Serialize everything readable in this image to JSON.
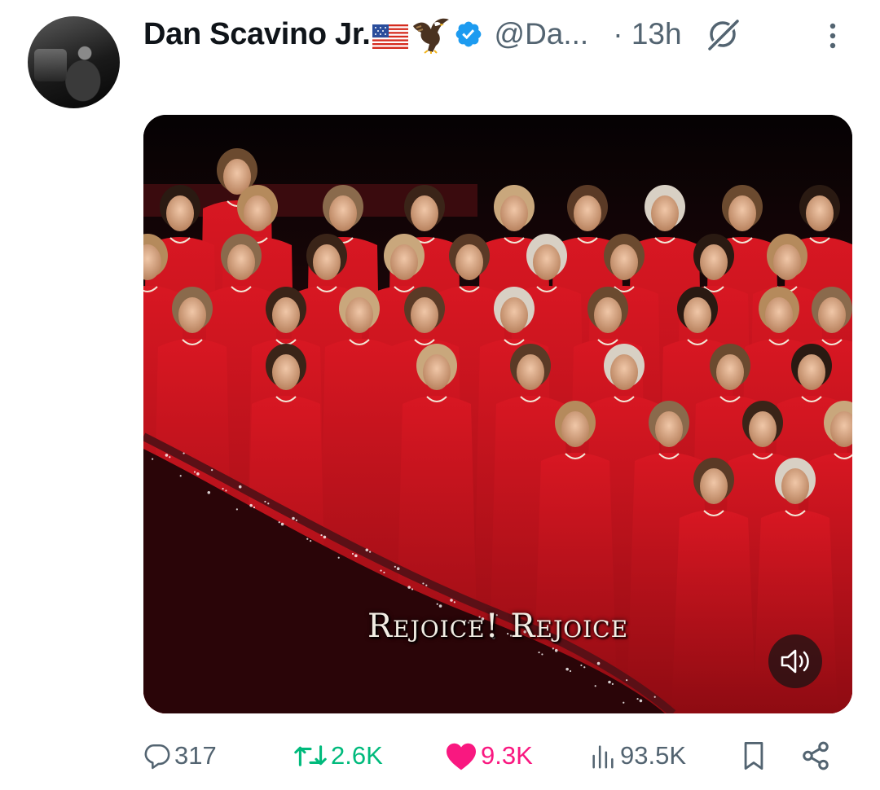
{
  "post": {
    "author_name": "Dan Scavino Jr.",
    "handle": "@Da...",
    "time": "· 13h",
    "video_caption": "Rejoice! Rejoice"
  },
  "stats": {
    "replies": "317",
    "reposts": "2.6K",
    "likes": "9.3K",
    "views": "93.5K"
  },
  "colors": {
    "verified": "#1d9bf0",
    "repost": "#00ba7c",
    "like": "#f91880",
    "muted": "#536471",
    "robe_red": "#c8141e"
  },
  "icons": {
    "avatar": "profile-photo",
    "flag": "us-flag-emoji",
    "eagle": "eagle-emoji",
    "verified": "verified-badge-icon",
    "grok": "grok-icon",
    "more": "more-vertical-icon",
    "sound": "speaker-icon",
    "reply": "reply-icon",
    "repost": "repost-icon",
    "like": "heart-icon",
    "views": "views-icon",
    "bookmark": "bookmark-icon",
    "share": "share-icon"
  }
}
